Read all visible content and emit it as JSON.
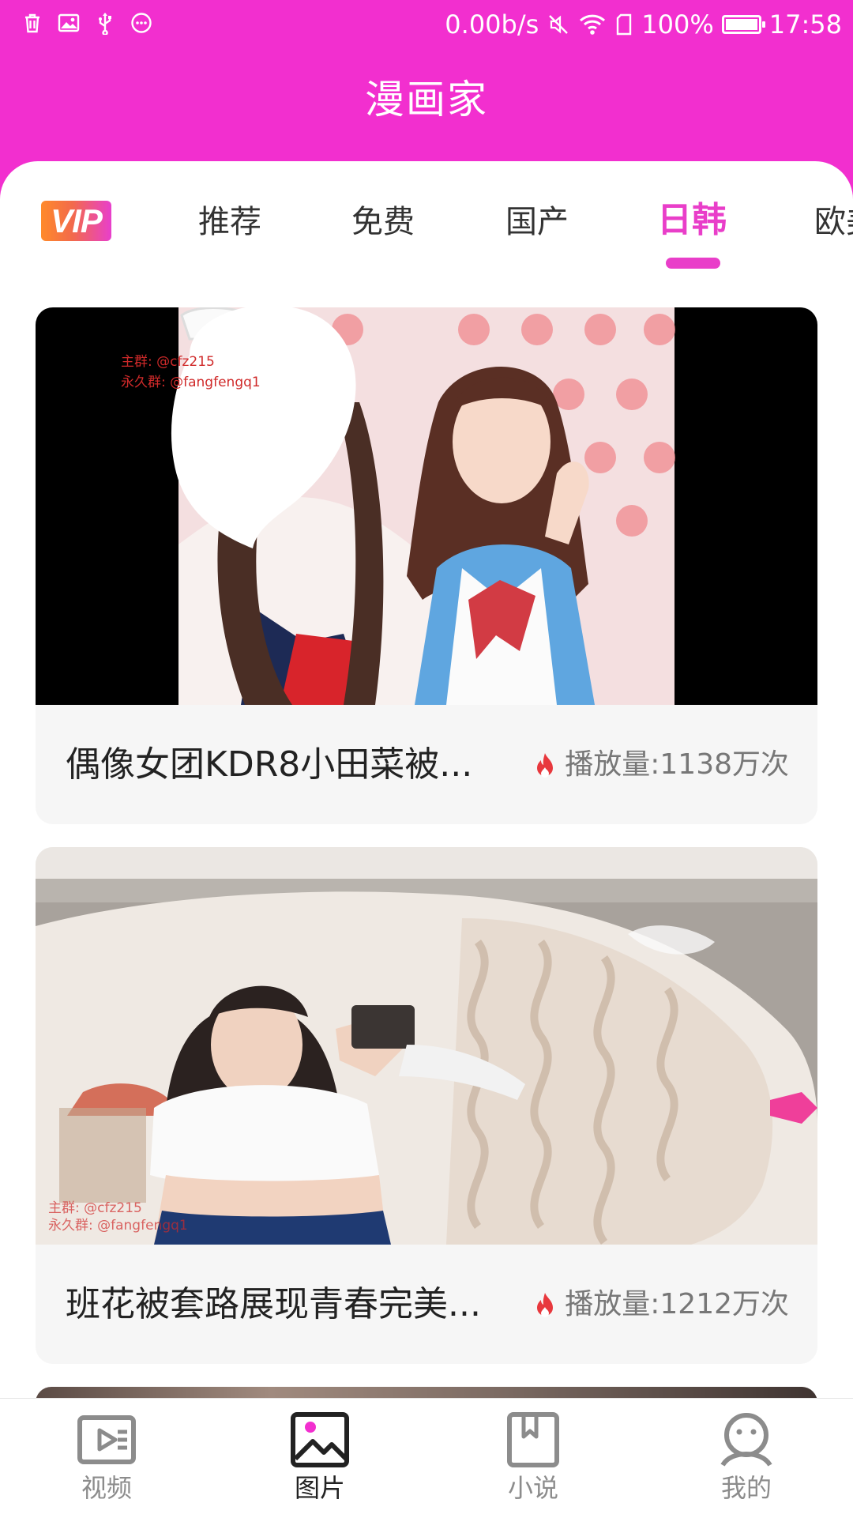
{
  "status_bar": {
    "network_speed": "0.00b/s",
    "battery_text": "100%",
    "battery_level": 1.0,
    "time": "17:58",
    "left_icons": [
      "trash-icon",
      "image-icon",
      "usb-icon",
      "more-icon"
    ],
    "right_icons": [
      "mute-icon",
      "wifi-icon",
      "sim-icon",
      "battery-icon"
    ]
  },
  "app_title": "漫画家",
  "tabs": {
    "vip_label": "VIP",
    "items": [
      "推荐",
      "免费",
      "国产",
      "日韩",
      "欧美"
    ],
    "active_index": 3
  },
  "cards": [
    {
      "watermark_line1": "主群: @cfz215",
      "watermark_line2": "永久群: @fangfengq1",
      "title": "偶像女团KDR8小田菜被...",
      "views": "播放量:1138万次"
    },
    {
      "watermark_line1": "主群: @cfz215",
      "watermark_line2": "永久群: @fangfengq1",
      "title": "班花被套路展现青春完美...",
      "views": "播放量:1212万次"
    }
  ],
  "bottom_nav": {
    "items": [
      {
        "label": "视频",
        "icon": "video-icon"
      },
      {
        "label": "图片",
        "icon": "image-icon"
      },
      {
        "label": "小说",
        "icon": "book-icon"
      },
      {
        "label": "我的",
        "icon": "profile-icon"
      }
    ],
    "active_index": 1
  },
  "colors": {
    "brand": "#f22fcf",
    "tab_active": "#e93ec9",
    "views_icon": "#e8383d",
    "nav_inactive": "#8c8c8c"
  }
}
